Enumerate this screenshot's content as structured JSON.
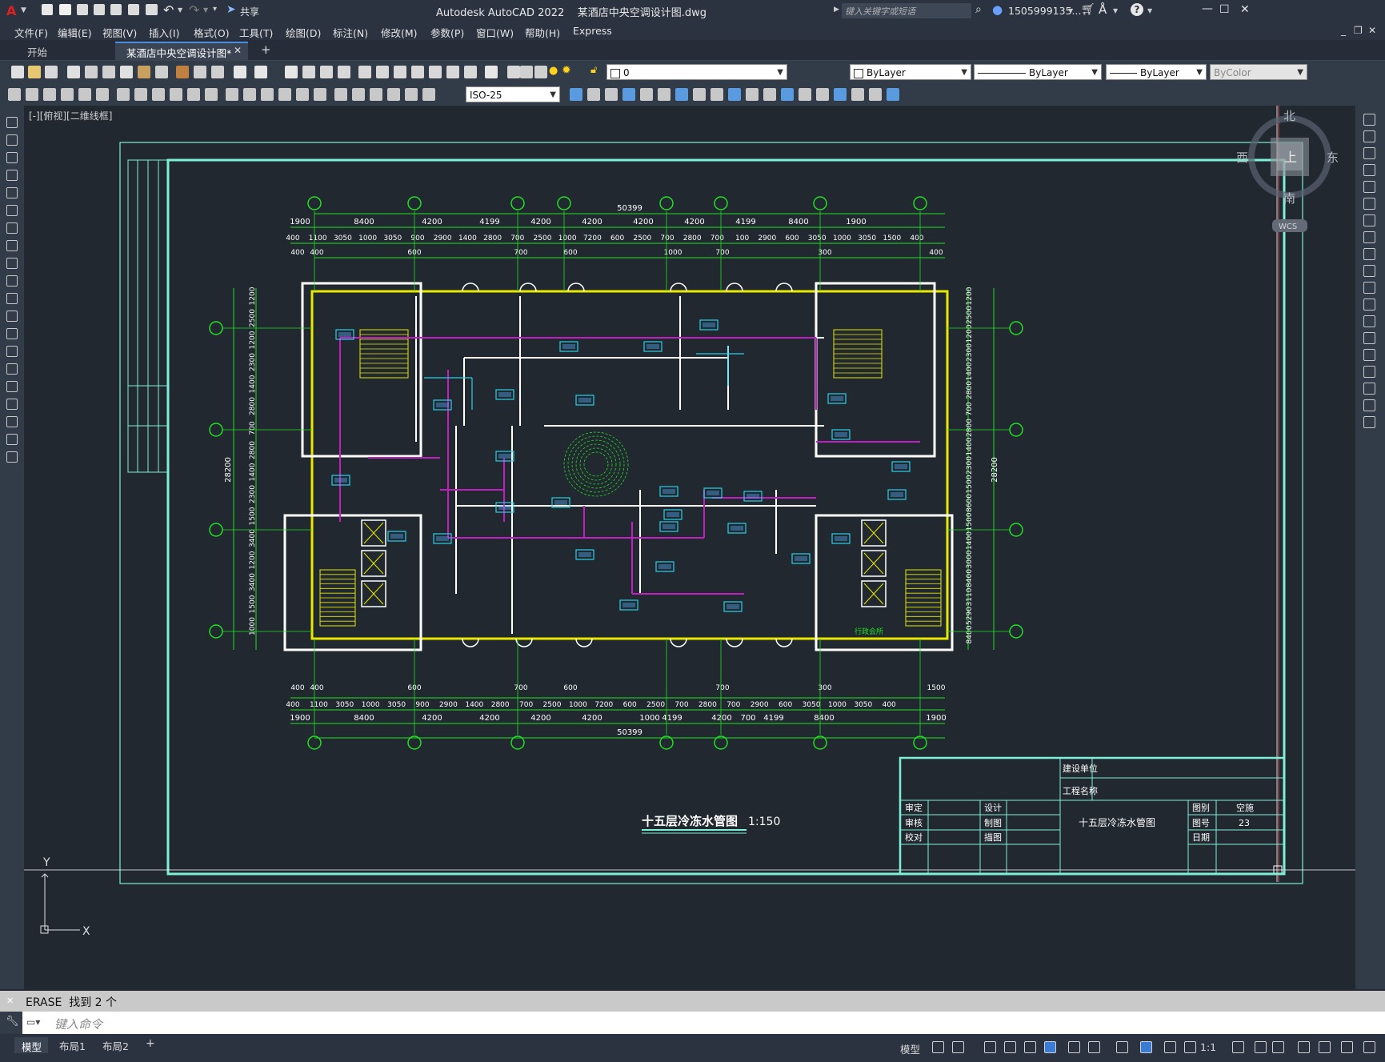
{
  "titlebar": {
    "app_icon": "A",
    "share": "共享",
    "title": "Autodesk AutoCAD 2022    某酒店中央空调设计图.dwg",
    "search_placeholder": "键入关键字或短语",
    "user": "1505999135...",
    "window_controls": [
      "—",
      "☐",
      "✕"
    ]
  },
  "menubar": {
    "items": [
      "文件(F)",
      "编辑(E)",
      "视图(V)",
      "插入(I)",
      "格式(O)",
      "工具(T)",
      "绘图(D)",
      "标注(N)",
      "修改(M)",
      "参数(P)",
      "窗口(W)",
      "帮助(H)",
      "Express"
    ]
  },
  "tabs": {
    "start": "开始",
    "active": "某酒店中央空调设计图*",
    "add": "+"
  },
  "properties": {
    "layer": "0",
    "color": "ByLayer",
    "linetype": "ByLayer",
    "lineweight": "ByLayer",
    "plotstyle": "ByColor",
    "dimstyle": "ISO-25"
  },
  "viewport": {
    "label": "[-][俯视][二维线框]",
    "viewcube": {
      "north": "北",
      "south": "南",
      "east": "东",
      "west": "西",
      "top": "上",
      "wcs": "WCS"
    },
    "ucs": {
      "x": "X",
      "y": "Y"
    }
  },
  "drawing": {
    "dim_top_total": "50399",
    "dim_top_row1": [
      "1900",
      "8400",
      "4200",
      "4199",
      "4200",
      "4200",
      "4200",
      "4200",
      "4199",
      "8400",
      "1900"
    ],
    "dim_top_row2": [
      "400",
      "1100",
      "3050",
      "1000",
      "3050",
      "900",
      "2900",
      "1400",
      "2800",
      "700",
      "2500",
      "1000",
      "7200",
      "600",
      "2500",
      "700",
      "2800",
      "700",
      "100",
      "2900",
      "600",
      "3050",
      "1000",
      "3050",
      "1500",
      "400"
    ],
    "dim_top_row3": [
      "400",
      "400",
      "600",
      "700",
      "600",
      "1000",
      "700",
      "300",
      "400"
    ],
    "dim_bottom_row1": [
      "400",
      "400",
      "600",
      "700",
      "600",
      "700",
      "300",
      "1500"
    ],
    "dim_bottom_row2": [
      "400",
      "1100",
      "3050",
      "1000",
      "3050",
      "900",
      "2900",
      "1400",
      "2800",
      "700",
      "2500",
      "1000",
      "7200",
      "600",
      "2500",
      "700",
      "2800",
      "700",
      "2900",
      "600",
      "3050",
      "1000",
      "3050",
      "400"
    ],
    "dim_bottom_row3": [
      "1900",
      "8400",
      "4200",
      "4200",
      "4200",
      "4200",
      "1000",
      "4199",
      "4200",
      "700",
      "4199",
      "8400",
      "1900"
    ],
    "dim_bottom_total": "50399",
    "dim_left_total": "28200",
    "dim_left": [
      "1200",
      "2500",
      "1200",
      "2300",
      "1400",
      "2800",
      "700",
      "2800",
      "1400",
      "2300",
      "1500",
      "3400",
      "1200",
      "3400",
      "1500",
      "1000"
    ],
    "dim_right_total": "28200",
    "dim_right": [
      "1200",
      "2500",
      "1200",
      "2300",
      "1400",
      "2800",
      "700",
      "2800",
      "1400",
      "2300",
      "1500",
      "8600",
      "1500",
      "1400",
      "3000",
      "8400",
      "3110",
      "5290",
      "8400"
    ],
    "drawing_title": "十五层冷冻水管图",
    "scale": "1:150",
    "footer_note": "行政会所"
  },
  "titleblock": {
    "org_label": "建设单位",
    "project_label": "工程名称",
    "rows_left": [
      "审定",
      "审核",
      "校对"
    ],
    "rows_mid": [
      "设计",
      "制图",
      "描图"
    ],
    "sheet_name": "十五层冷冻水管图",
    "right_labels": [
      "图别",
      "图号",
      "日期"
    ],
    "right_values": [
      "空施",
      "23",
      ""
    ]
  },
  "command": {
    "history": "ERASE  找到 2 个",
    "placeholder": "键入命令"
  },
  "statusbar": {
    "model_tab": "模型",
    "layout1": "布局1",
    "layout2": "布局2",
    "add": "+",
    "model_label": "模型",
    "scale": "1:1"
  },
  "colors": {
    "grid_green": "#21e021",
    "wall_yellow": "#e8e800",
    "pipe_magenta": "#c020c0",
    "frame_cyan": "#7ef0d8",
    "wall_white": "#ffffff",
    "duct_cyan": "#2ad0e8"
  }
}
